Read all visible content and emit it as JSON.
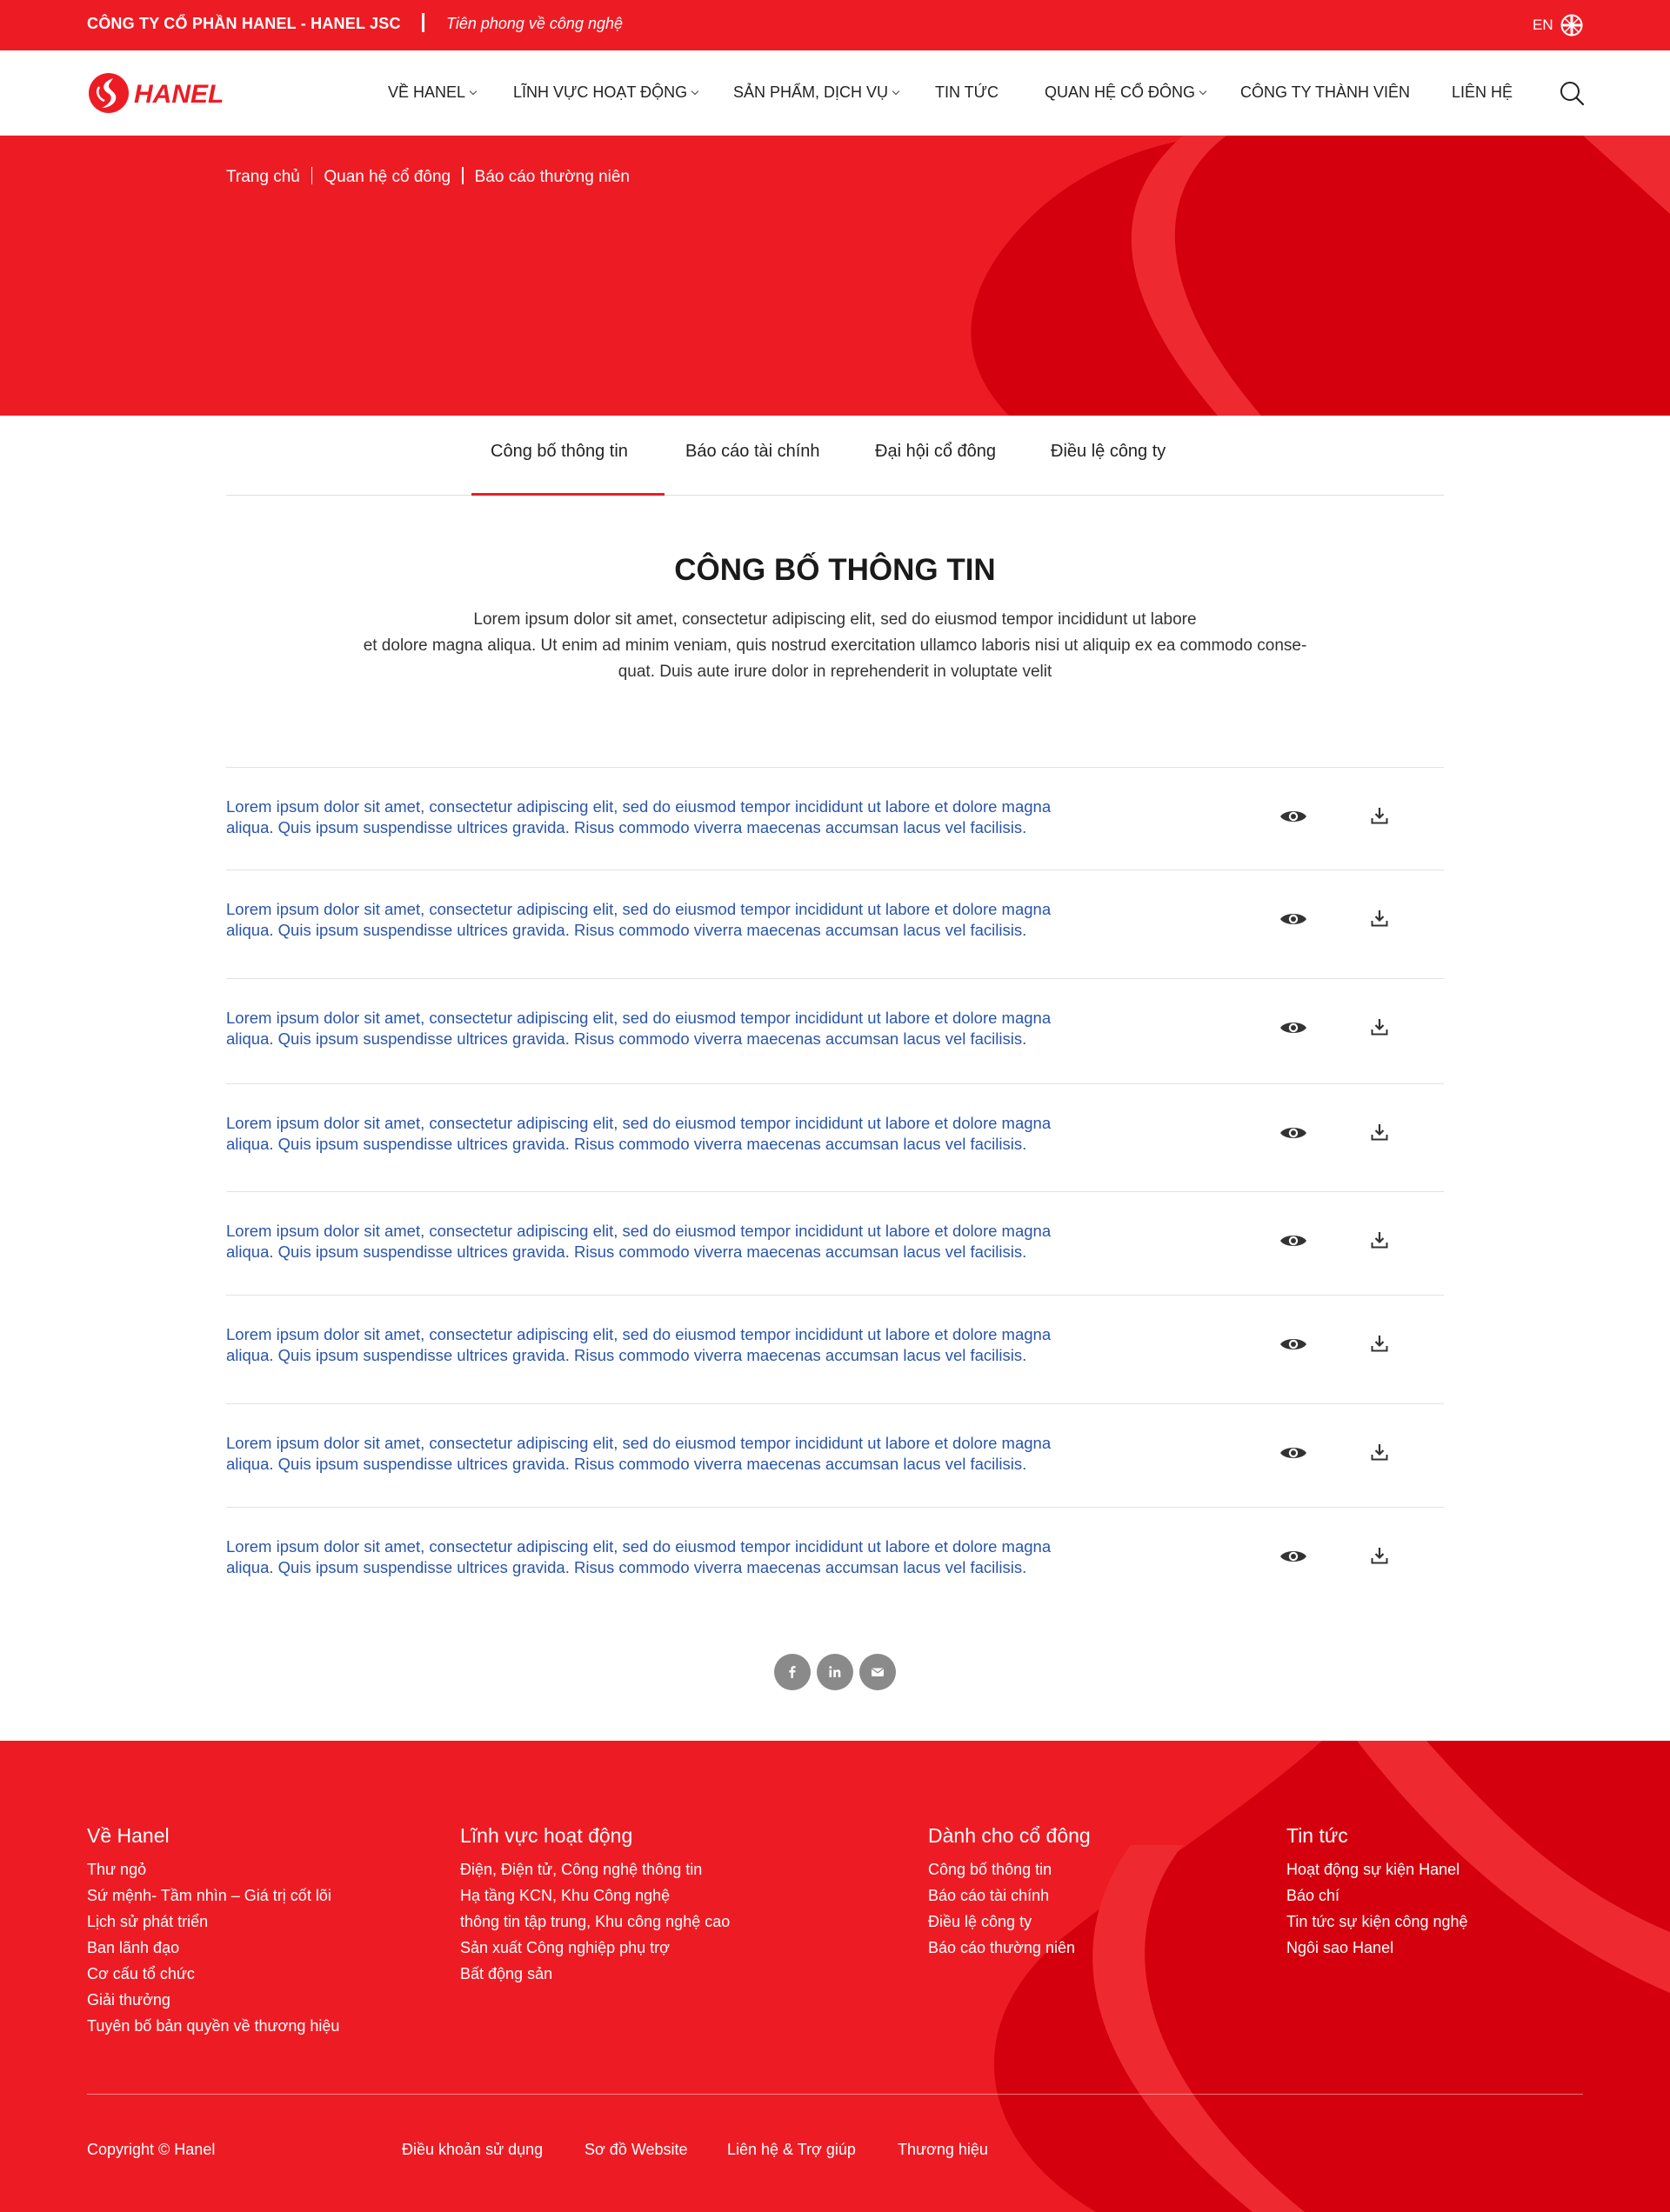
{
  "topbar": {
    "company": "CÔNG TY CỔ PHẦN HANEL - HANEL JSC",
    "slogan": "Tiên phong về công nghệ",
    "lang": "EN"
  },
  "logo": {
    "text": "HANEL"
  },
  "nav": [
    {
      "label": "VỀ HANEL",
      "has_dropdown": true
    },
    {
      "label": "LĨNH VỰC HOẠT ĐỘNG",
      "has_dropdown": true
    },
    {
      "label": "SẢN PHẨM, DỊCH VỤ",
      "has_dropdown": true
    },
    {
      "label": "TIN TỨC",
      "has_dropdown": false
    },
    {
      "label": "QUAN HỆ CỔ ĐÔNG",
      "has_dropdown": true
    },
    {
      "label": "CÔNG TY THÀNH VIÊN",
      "has_dropdown": false
    },
    {
      "label": "LIÊN HỆ",
      "has_dropdown": false
    }
  ],
  "breadcrumb": [
    "Trang chủ",
    "Quan hệ cổ đông",
    "Báo cáo thường niên"
  ],
  "tabs": [
    {
      "label": "Công bố thông tin",
      "active": true
    },
    {
      "label": "Báo cáo tài chính",
      "active": false
    },
    {
      "label": "Đại hội cổ đông",
      "active": false
    },
    {
      "label": "Điều lệ công ty",
      "active": false
    }
  ],
  "section": {
    "title": "CÔNG BỐ THÔNG TIN",
    "desc_lines": [
      "Lorem ipsum dolor sit amet, consectetur adipiscing elit, sed do eiusmod tempor incididunt ut labore",
      "et dolore magna aliqua. Ut enim ad minim veniam, quis nostrud exercitation ullamco laboris nisi ut aliquip ex ea commodo conse-",
      "quat. Duis aute irure dolor in reprehenderit in voluptate velit"
    ]
  },
  "documents": [
    {
      "line1": "Lorem ipsum dolor sit amet, consectetur adipiscing elit, sed do eiusmod tempor incididunt ut labore et dolore magna",
      "line2": "aliqua. Quis ipsum suspendisse ultrices gravida. Risus commodo viverra maecenas accumsan lacus vel facilisis."
    },
    {
      "line1": "Lorem ipsum dolor sit amet, consectetur adipiscing elit, sed do eiusmod tempor incididunt ut labore et dolore magna",
      "line2": "aliqua. Quis ipsum suspendisse ultrices gravida. Risus commodo viverra maecenas accumsan lacus vel facilisis."
    },
    {
      "line1": "Lorem ipsum dolor sit amet, consectetur adipiscing elit, sed do eiusmod tempor incididunt ut labore et dolore magna",
      "line2": "aliqua. Quis ipsum suspendisse ultrices gravida. Risus commodo viverra maecenas accumsan lacus vel facilisis."
    },
    {
      "line1": "Lorem ipsum dolor sit amet, consectetur adipiscing elit, sed do eiusmod tempor incididunt ut labore et dolore magna",
      "line2": "aliqua. Quis ipsum suspendisse ultrices gravida. Risus commodo viverra maecenas accumsan lacus vel facilisis."
    },
    {
      "line1": "Lorem ipsum dolor sit amet, consectetur adipiscing elit, sed do eiusmod tempor incididunt ut labore et dolore magna",
      "line2": "aliqua. Quis ipsum suspendisse ultrices gravida. Risus commodo viverra maecenas accumsan lacus vel facilisis."
    },
    {
      "line1": "Lorem ipsum dolor sit amet, consectetur adipiscing elit, sed do eiusmod tempor incididunt ut labore et dolore magna",
      "line2": "aliqua. Quis ipsum suspendisse ultrices gravida. Risus commodo viverra maecenas accumsan lacus vel facilisis."
    },
    {
      "line1": "Lorem ipsum dolor sit amet, consectetur adipiscing elit, sed do eiusmod tempor incididunt ut labore et dolore magna",
      "line2": "aliqua. Quis ipsum suspendisse ultrices gravida. Risus commodo viverra maecenas accumsan lacus vel facilisis."
    },
    {
      "line1": "Lorem ipsum dolor sit amet, consectetur adipiscing elit, sed do eiusmod tempor incididunt ut labore et dolore magna",
      "line2": "aliqua. Quis ipsum suspendisse ultrices gravida. Risus commodo viverra maecenas accumsan lacus vel facilisis."
    }
  ],
  "share": [
    "facebook-icon",
    "linkedin-icon",
    "mail-icon"
  ],
  "footer": {
    "columns": [
      {
        "title": "Về Hanel",
        "items": [
          "Thư ngỏ",
          "Sứ mệnh- Tầm nhìn – Giá trị cốt lõi",
          "Lịch sử phát triển",
          "Ban lãnh đạo",
          "Cơ cấu tổ chức",
          "Giải thưởng",
          "Tuyên bố bản quyền về thương hiệu"
        ]
      },
      {
        "title": "Lĩnh vực hoạt động",
        "items": [
          "Điện, Điện tử, Công nghệ thông tin",
          "Hạ tầng KCN, Khu Công nghệ",
          "thông tin tập trung, Khu công nghệ cao",
          "Sản xuất Công nghiệp phụ trợ",
          "Bất động sản"
        ]
      },
      {
        "title": "Dành cho cổ đông",
        "items": [
          "Công bố thông tin",
          "Báo cáo tài chính",
          "Điều lệ công ty",
          "Báo cáo thường niên"
        ]
      },
      {
        "title": "Tin tức",
        "items": [
          "Hoạt động sự kiện Hanel",
          "Báo chí",
          "Tin tức sự kiện công nghệ",
          "Ngôi sao Hanel"
        ]
      }
    ],
    "copyright": "Copyright © Hanel",
    "links": [
      "Điều khoản sử dụng",
      "Sơ đồ Website",
      "Liên hệ & Trợ giúp",
      "Thương hiệu"
    ]
  },
  "colors": {
    "brand_red": "#ed1c24",
    "dark_red": "#c8000c",
    "link_blue": "#2a55a8",
    "icon_grey": "#8a8a8a"
  }
}
